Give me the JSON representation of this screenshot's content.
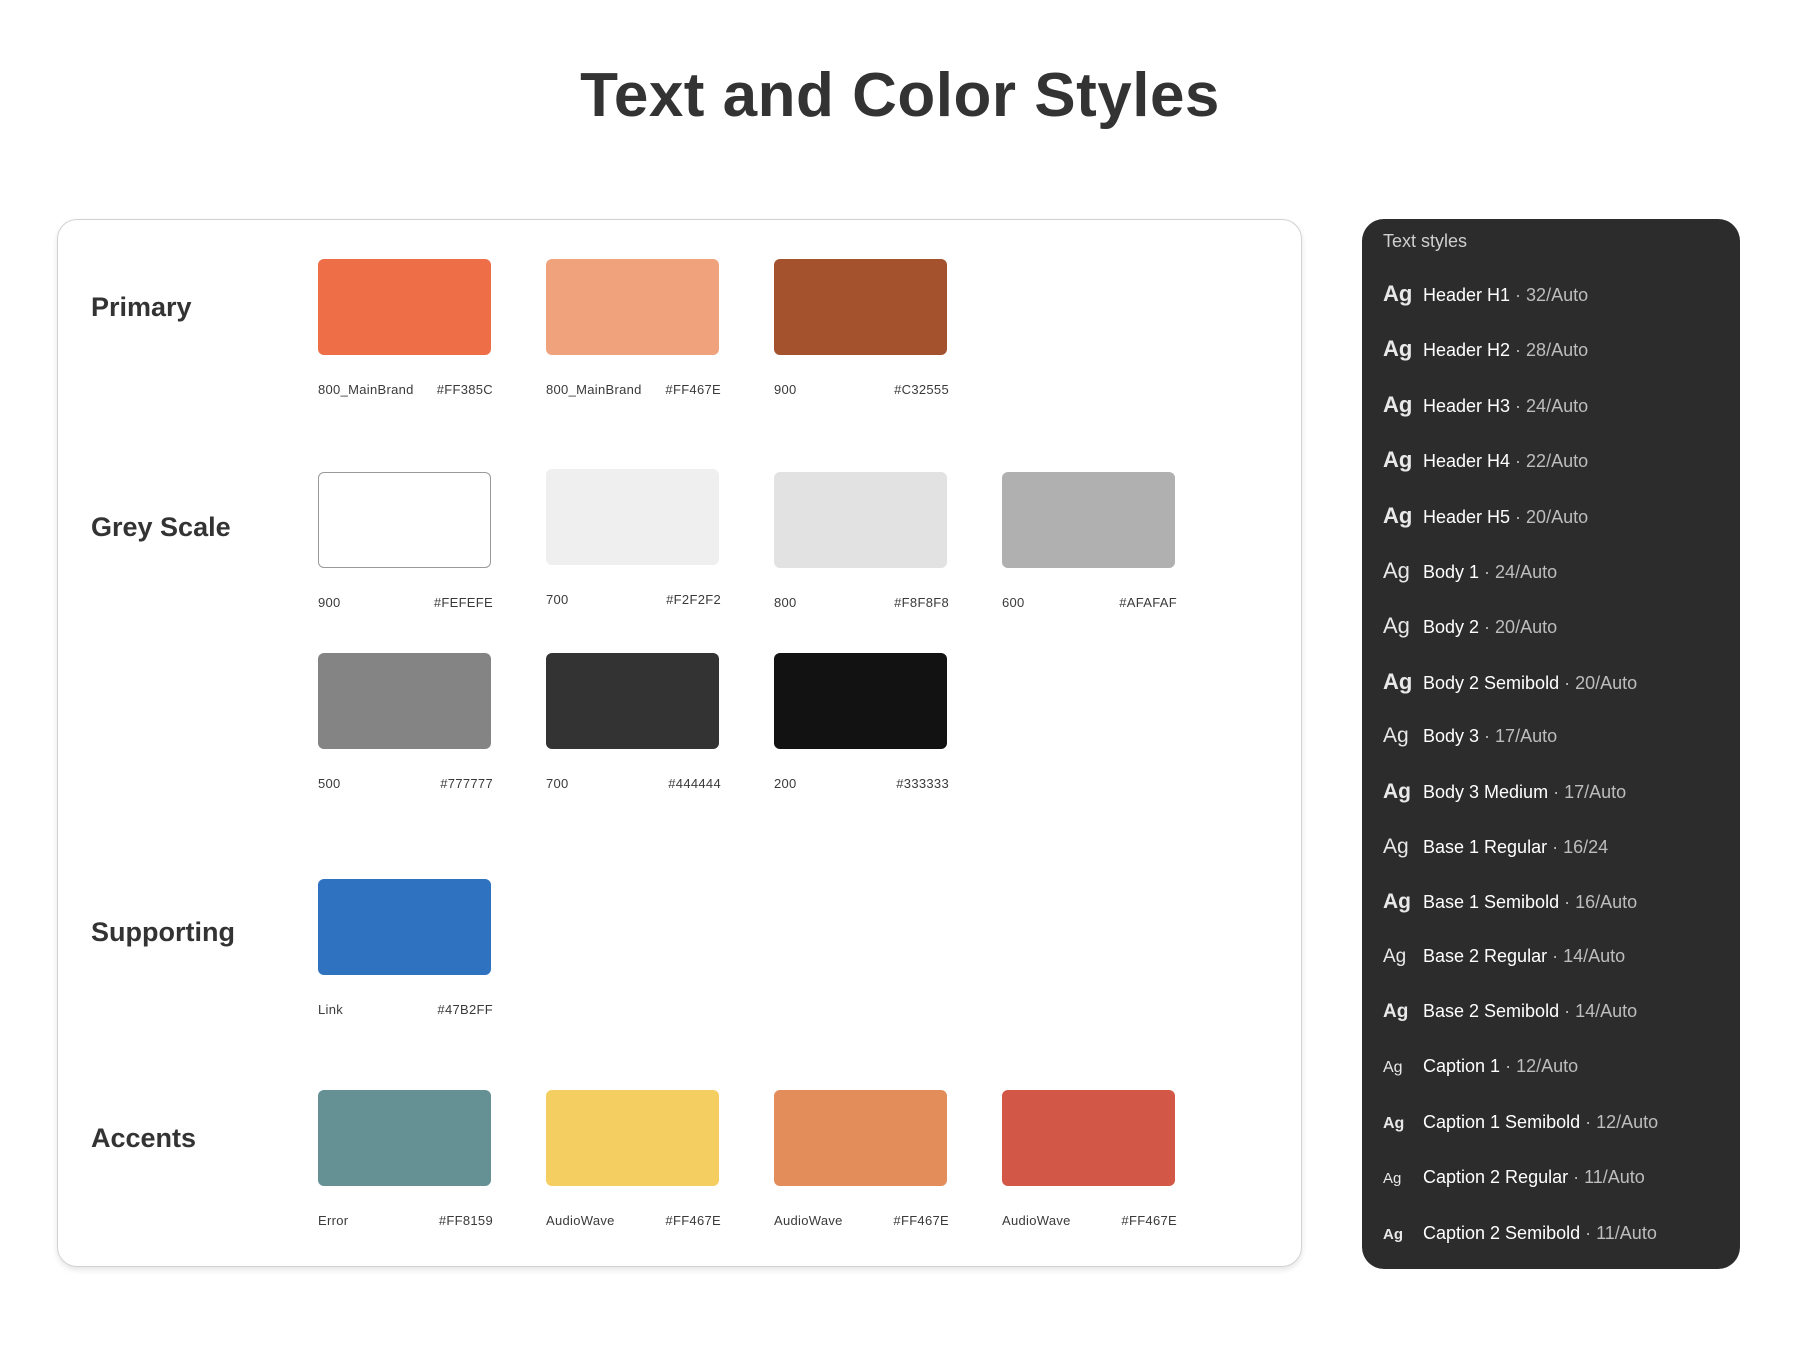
{
  "page": {
    "title": "Text and Color Styles"
  },
  "sections": {
    "primary": {
      "label": "Primary",
      "swatches": [
        {
          "name": "800_MainBrand",
          "hex": "#FF385C",
          "color": "#EE6F47"
        },
        {
          "name": "800_MainBrand",
          "hex": "#FF467E",
          "color": "#F0A27C"
        },
        {
          "name": "900",
          "hex": "#C32555",
          "color": "#A4512D"
        }
      ]
    },
    "grey": {
      "label": "Grey Scale",
      "swatches": [
        {
          "name": "900",
          "hex": "#FEFEFE",
          "color": "#FFFFFF"
        },
        {
          "name": "700",
          "hex": "#F2F2F2",
          "color": "#EFEFEF"
        },
        {
          "name": "800",
          "hex": "#F8F8F8",
          "color": "#E2E2E2"
        },
        {
          "name": "600",
          "hex": "#AFAFAF",
          "color": "#B0B0B0"
        },
        {
          "name": "500",
          "hex": "#777777",
          "color": "#848484"
        },
        {
          "name": "700",
          "hex": "#444444",
          "color": "#333333"
        },
        {
          "name": "200",
          "hex": "#333333",
          "color": "#121212"
        }
      ]
    },
    "supporting": {
      "label": "Supporting",
      "swatches": [
        {
          "name": "Link",
          "hex": "#47B2FF",
          "color": "#2E72C0"
        }
      ]
    },
    "accents": {
      "label": "Accents",
      "swatches": [
        {
          "name": "Error",
          "hex": "#FF8159",
          "color": "#659195"
        },
        {
          "name": "AudioWave",
          "hex": "#FF467E",
          "color": "#F4CE60"
        },
        {
          "name": "AudioWave",
          "hex": "#FF467E",
          "color": "#E28D5A"
        },
        {
          "name": "AudioWave",
          "hex": "#FF467E",
          "color": "#D35746"
        }
      ]
    }
  },
  "text_styles": {
    "title": "Text styles",
    "sample": "Ag",
    "separator": "·",
    "items": [
      {
        "name": "Header H1",
        "size": "32/Auto",
        "ag_size": 22,
        "ag_weight": 700
      },
      {
        "name": "Header H2",
        "size": "28/Auto",
        "ag_size": 22,
        "ag_weight": 700
      },
      {
        "name": "Header H3",
        "size": "24/Auto",
        "ag_size": 22,
        "ag_weight": 700
      },
      {
        "name": "Header H4",
        "size": "22/Auto",
        "ag_size": 22,
        "ag_weight": 700
      },
      {
        "name": "Header H5",
        "size": "20/Auto",
        "ag_size": 22,
        "ag_weight": 700
      },
      {
        "name": "Body 1",
        "size": "24/Auto",
        "ag_size": 22,
        "ag_weight": 400
      },
      {
        "name": "Body 2",
        "size": "20/Auto",
        "ag_size": 22,
        "ag_weight": 400
      },
      {
        "name": "Body 2 Semibold",
        "size": "20/Auto",
        "ag_size": 22,
        "ag_weight": 700
      },
      {
        "name": "Body 3",
        "size": "17/Auto",
        "ag_size": 21,
        "ag_weight": 400
      },
      {
        "name": "Body 3 Medium",
        "size": "17/Auto",
        "ag_size": 21,
        "ag_weight": 700
      },
      {
        "name": "Base 1 Regular",
        "size": "16/24",
        "ag_size": 21,
        "ag_weight": 400
      },
      {
        "name": "Base 1 Semibold",
        "size": "16/Auto",
        "ag_size": 21,
        "ag_weight": 700
      },
      {
        "name": "Base 2 Regular",
        "size": "14/Auto",
        "ag_size": 19,
        "ag_weight": 400
      },
      {
        "name": "Base 2 Semibold",
        "size": "14/Auto",
        "ag_size": 19,
        "ag_weight": 700
      },
      {
        "name": "Caption 1",
        "size": "12/Auto",
        "ag_size": 16,
        "ag_weight": 400
      },
      {
        "name": "Caption 1 Semibold",
        "size": "12/Auto",
        "ag_size": 16,
        "ag_weight": 700
      },
      {
        "name": "Caption 2 Regular",
        "size": "11/Auto",
        "ag_size": 15,
        "ag_weight": 400
      },
      {
        "name": "Caption 2 Semibold",
        "size": "11/Auto",
        "ag_size": 15,
        "ag_weight": 700
      }
    ]
  }
}
